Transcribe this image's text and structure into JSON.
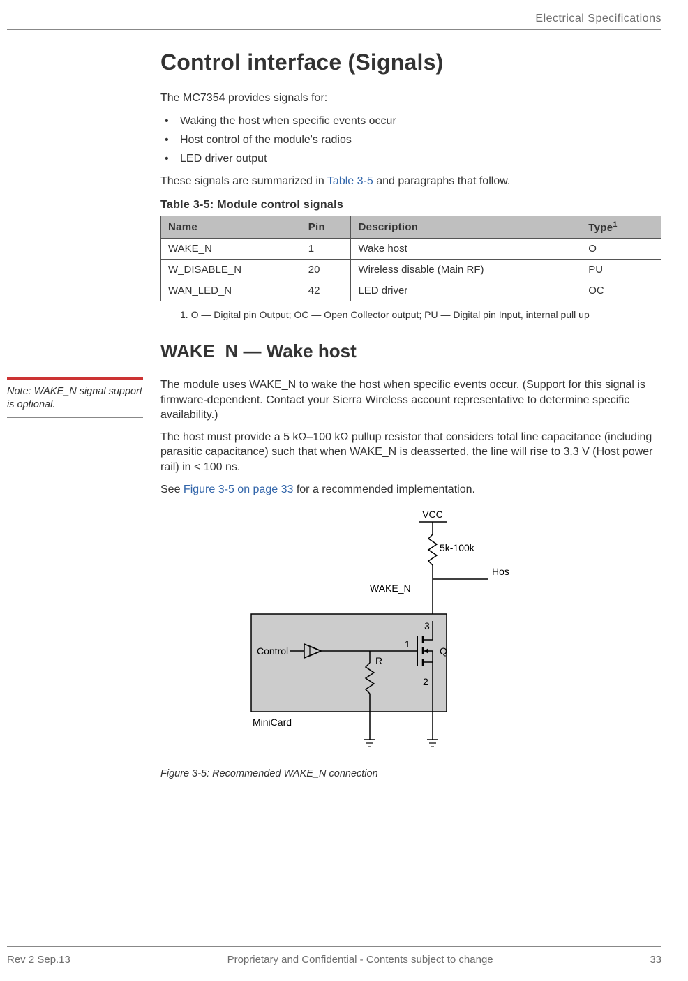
{
  "header": {
    "section": "Electrical Specifications"
  },
  "h1": "Control interface (Signals)",
  "intro": "The MC7354 provides signals for:",
  "bullets": [
    "Waking the host when specific events occur",
    "Host control of the module's radios",
    "LED driver output"
  ],
  "after_bullets_pre": "These signals are summarized in ",
  "after_bullets_link": "Table 3-5",
  "after_bullets_post": " and paragraphs that follow.",
  "table": {
    "caption": "Table 3-5:  Module control signals",
    "headers": {
      "name": "Name",
      "pin": "Pin",
      "desc": "Description",
      "type": "Type",
      "type_sup": "1"
    },
    "rows": [
      {
        "name": "WAKE_N",
        "pin": "1",
        "desc": "Wake host",
        "type": "O"
      },
      {
        "name": "W_DISABLE_N",
        "pin": "20",
        "desc": "Wireless disable (Main RF)",
        "type": "PU"
      },
      {
        "name": "WAN_LED_N",
        "pin": "42",
        "desc": "LED driver",
        "type": "OC"
      }
    ],
    "footnote": "1.   O — Digital pin Output; OC — Open Collector output; PU — Digital pin Input, internal pull up"
  },
  "h2": "WAKE_N — Wake host",
  "side_note": "Note:  WAKE_N signal support is optional.",
  "para1_pre": "The module uses ",
  "para1_sig": "WAKE_N",
  "para1_post": " to wake the host when specific events occur. (Support for this signal is firmware-dependent. Contact your Sierra Wireless account representative to determine specific availability.)",
  "para2": "The host must provide a 5 kΩ–100 kΩ pullup resistor that considers total line capacitance (including parasitic capacitance) such that when WAKE_N is deasserted, the line will rise to 3.3 V (Host power rail) in < 100 ns.",
  "para3_pre": "See ",
  "para3_link": "Figure 3-5 on page 33",
  "para3_post": " for a recommended implementation.",
  "figure": {
    "labels": {
      "vcc": "VCC",
      "res": "5k-100k",
      "host": "Host",
      "wake_n": "WAKE_N",
      "n3": "3",
      "n1": "1",
      "q": "Q",
      "n2": "2",
      "r": "R",
      "control": "Control",
      "minicard": "MiniCard"
    },
    "caption": "Figure 3-5:  Recommended WAKE_N connection"
  },
  "footer": {
    "left": "Rev 2  Sep.13",
    "center": "Proprietary and Confidential - Contents subject to change",
    "right": "33"
  }
}
